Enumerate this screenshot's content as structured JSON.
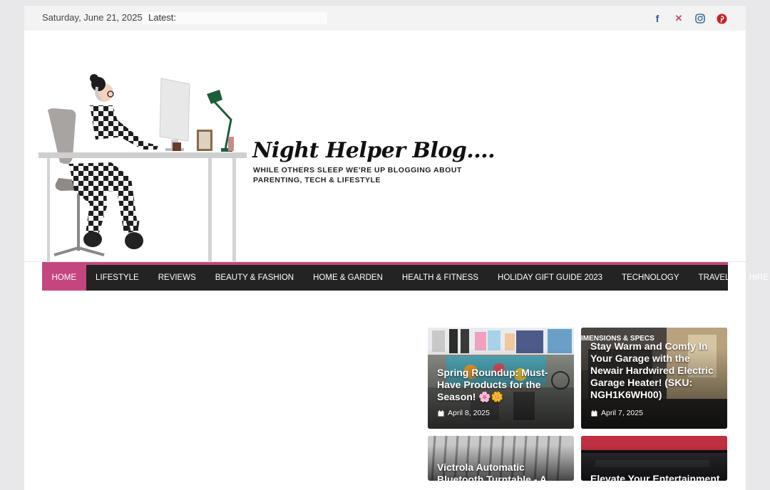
{
  "topbar": {
    "date": "Saturday, June 21, 2025",
    "latest_label": "Latest:",
    "social": [
      {
        "icon": "facebook-icon",
        "glyph": "f",
        "color": "#3b5998"
      },
      {
        "icon": "x-twitter-icon",
        "glyph": "𝕏",
        "color": "#c5467f"
      },
      {
        "icon": "instagram-icon",
        "glyph": "◎",
        "color": "#3f729b"
      },
      {
        "icon": "pinterest-icon",
        "glyph": "P",
        "color": "#cb2027"
      }
    ]
  },
  "header": {
    "title": "Night Helper Blog....",
    "tagline": "WHILE OTHERS SLEEP WE'RE UP BLOGGING ABOUT PARENTING, TECH & LIFESTYLE"
  },
  "nav": {
    "accent": "#c5467f",
    "items": [
      {
        "label": "HOME",
        "active": true
      },
      {
        "label": "LIFESTYLE"
      },
      {
        "label": "REVIEWS"
      },
      {
        "label": "BEAUTY & FASHION"
      },
      {
        "label": "HOME & GARDEN"
      },
      {
        "label": "HEALTH & FITNESS"
      },
      {
        "label": "HOLIDAY GIFT GUIDE 2023"
      },
      {
        "label": "TECHNOLOGY"
      },
      {
        "label": "TRAVEL"
      },
      {
        "label": "HIRE ME",
        "dropdown": true
      }
    ]
  },
  "posts": [
    {
      "title": "Spring Roundup: Must-Have Products for the Season! 🌸🌼",
      "date": "April 8, 2025"
    },
    {
      "title": "Stay Warm and Comfy In Your Garage with the Newair Hardwired Electric Garage Heater! (SKU: NGH1K6WH00)",
      "date": "April 7, 2025",
      "overlay_text": "IMENSIONS & SPECS"
    },
    {
      "title": "Victrola Automatic Bluetooth Turntable - A"
    },
    {
      "title": "Elevate Your Entertainment"
    }
  ]
}
